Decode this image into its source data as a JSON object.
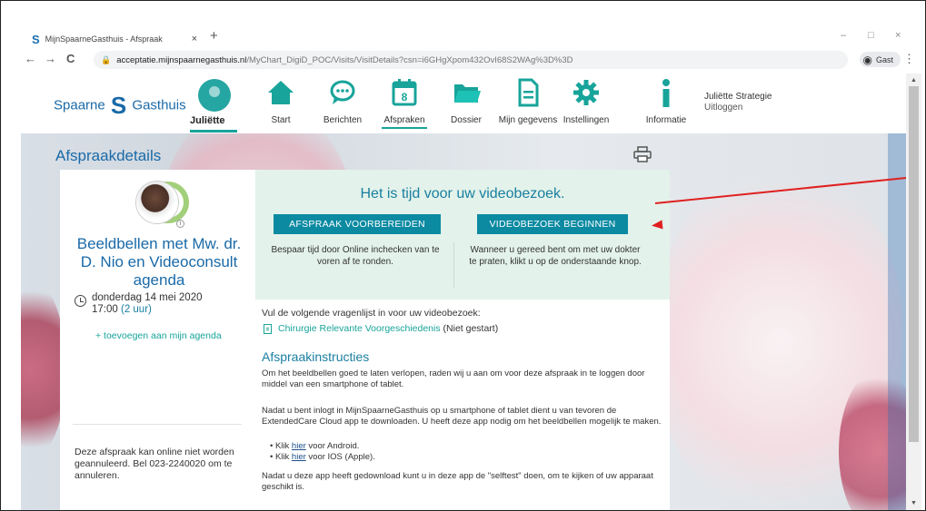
{
  "browser": {
    "tab_title": "MijnSpaarneGasthuis - Afspraak",
    "tab_close": "×",
    "new_tab": "+",
    "window_controls": [
      "–",
      "□",
      "×"
    ],
    "nav": {
      "back": "←",
      "forward": "→",
      "reload": "C"
    },
    "url_host": "acceptatie.mijnspaarnegasthuis.nl",
    "url_path": "/MyChart_DigiD_POC/Visits/VisitDetails?csn=i6GHgXpom432OvI68S2WAg%3D%3D",
    "guest_label": "Gast",
    "menu": "⋮"
  },
  "site": {
    "logo_left": "Spaarne",
    "logo_mark": "S",
    "logo_right": "Gasthuis",
    "user_tab": "Juliëtte",
    "nav": [
      {
        "label": "Start",
        "icon": "home-icon"
      },
      {
        "label": "Berichten",
        "icon": "chat-icon"
      },
      {
        "label": "Afspraken",
        "icon": "calendar-icon",
        "calendar_day": "8",
        "active": true
      },
      {
        "label": "Dossier",
        "icon": "folder-icon"
      },
      {
        "label": "Mijn gegevens",
        "icon": "document-icon"
      },
      {
        "label": "Instellingen",
        "icon": "gear-icon"
      },
      {
        "label": "Informatie",
        "icon": "info-icon"
      }
    ],
    "user_name": "Juliëtte Strategie",
    "logout": "Uitloggen",
    "colors": {
      "brand": "#1a6aa8",
      "accent": "#18a49a",
      "button": "#0b8aa2",
      "banner": "#e3f2ea",
      "annotation": "#e02020"
    }
  },
  "page": {
    "title": "Afspraakdetails",
    "print_icon": "printer-icon",
    "appointment": {
      "title": "Beeldbellen met Mw. dr. D. Nio en Videoconsult agenda",
      "date": "donderdag 14 mei 2020",
      "time": "17:00",
      "duration": "(2 uur)",
      "add_to_calendar": "+ toevoegen aan mijn agenda",
      "info_badge": "i",
      "cancel_note": "Deze afspraak kan online niet worden geannuleerd. Bel 023-2240020 om te annuleren."
    },
    "banner": {
      "title": "Het is tijd voor uw videobezoek.",
      "prepare_button": "AFSPRAAK VOORBEREIDEN",
      "prepare_desc": "Bespaar tijd door Online inchecken van te voren af te ronden.",
      "start_button": "VIDEOBEZOEK BEGINNEN",
      "start_desc": "Wanneer u gereed bent om met uw dokter te praten, klikt u op de onderstaande knop."
    },
    "questionnaire": {
      "intro": "Vul de volgende vragenlijst in voor uw videobezoek:",
      "link": "Chirurgie Relevante Voorgeschiedenis",
      "status": "(Niet gestart)"
    },
    "instructions": {
      "title": "Afspraakinstructies",
      "p1": "Om het beeldbellen goed te laten verlopen, raden wij u aan om voor deze afspraak in te loggen door middel van een smartphone of tablet.",
      "p2": "Nadat u bent inlogt in MijnSpaarneGasthuis op u smartphone of tablet dient u van tevoren de ExtendedCare Cloud app te downloaden. U heeft deze app nodig om het beeldbellen mogelijk te maken.",
      "bullet1_pre": "Klik ",
      "bullet1_link": "hier",
      "bullet1_post": " voor Android.",
      "bullet2_pre": "Klik ",
      "bullet2_link": "hier",
      "bullet2_post": " voor IOS (Apple).",
      "p3": "Nadat u deze app heeft gedownload kunt u in deze app de \"selftest\" doen, om te kijken of uw apparaat geschikt is."
    }
  }
}
